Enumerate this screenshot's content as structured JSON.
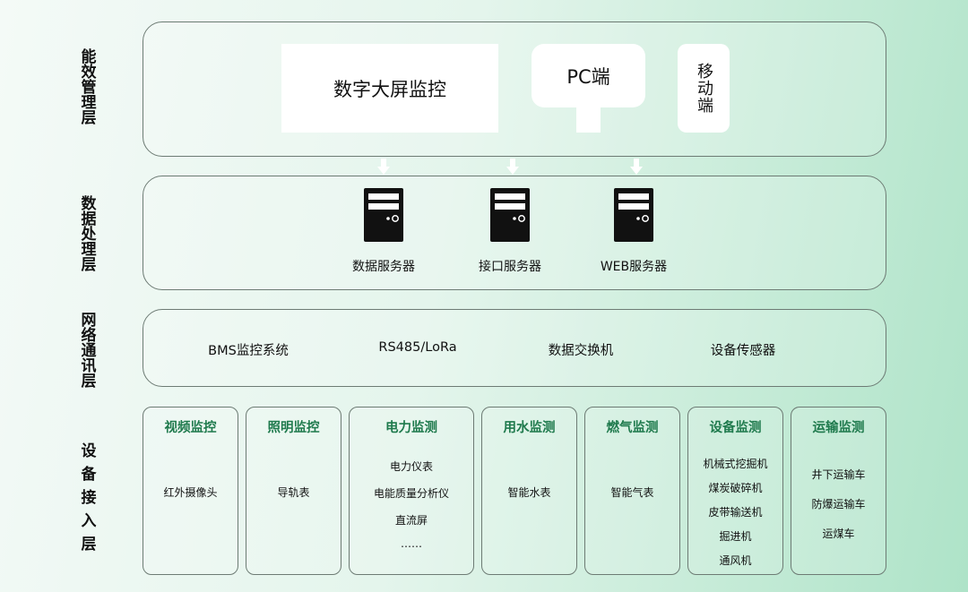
{
  "side_labels": {
    "energy_mgmt": "能效管理层",
    "data_proc": "数据处理层",
    "network": "网络通讯层",
    "device_access": "设备接入层"
  },
  "top_layer": {
    "big_screen": "数字大屏监控",
    "pc": "PC端",
    "mobile": "移动端"
  },
  "servers": [
    {
      "label": "数据服务器"
    },
    {
      "label": "接口服务器"
    },
    {
      "label": "WEB服务器"
    }
  ],
  "network": [
    "BMS监控系统",
    "RS485/LoRa",
    "数据交换机",
    "设备传感器"
  ],
  "devices": [
    {
      "title": "视频监控",
      "items": [
        "红外摄像头"
      ]
    },
    {
      "title": "照明监控",
      "items": [
        "导轨表"
      ]
    },
    {
      "title": "电力监测",
      "items": [
        "电力仪表",
        "电能质量分析仪",
        "直流屏",
        "……"
      ]
    },
    {
      "title": "用水监测",
      "items": [
        "智能水表"
      ]
    },
    {
      "title": "燃气监测",
      "items": [
        "智能气表"
      ]
    },
    {
      "title": "设备监测",
      "items": [
        "机械式挖掘机",
        "煤炭破碎机",
        "皮带输送机",
        "掘进机",
        "通风机"
      ]
    },
    {
      "title": "运输监测",
      "items": [
        "井下运输车",
        "防爆运输车",
        "运煤车"
      ]
    }
  ],
  "colors": {
    "title_green": "#1f7a4d",
    "border": "#6d7b74",
    "server_dark": "#111111"
  }
}
